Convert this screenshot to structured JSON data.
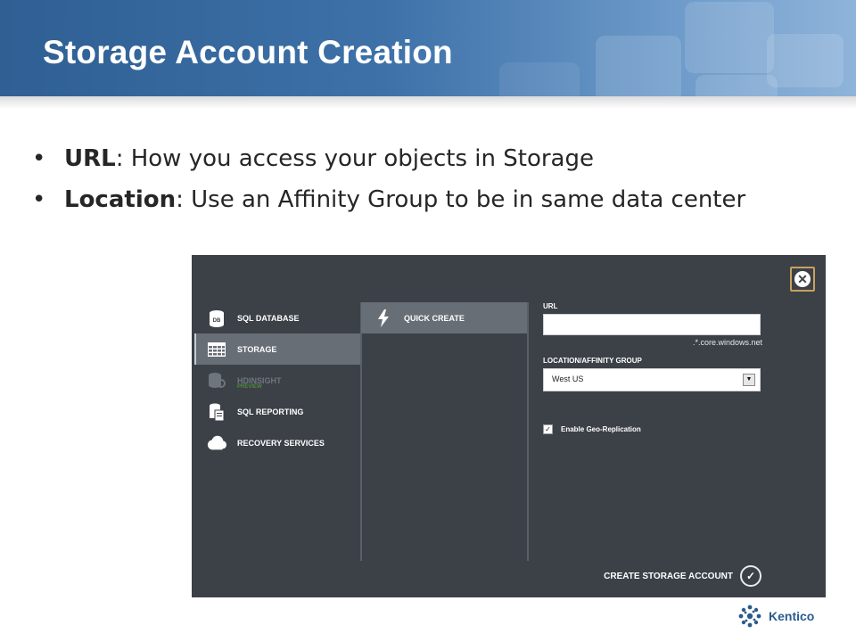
{
  "slide": {
    "title": "Storage Account Creation",
    "bullets": [
      {
        "term": "URL",
        "text": ": How you access your objects in Storage"
      },
      {
        "term": "Location",
        "text": ": Use an Affinity Group to be in same data center"
      }
    ]
  },
  "portal": {
    "services": [
      {
        "label": "SQL DATABASE",
        "icon": "database-icon",
        "selected": false,
        "disabled": false
      },
      {
        "label": "STORAGE",
        "icon": "storage-table-icon",
        "selected": true,
        "disabled": false
      },
      {
        "label": "HDINSIGHT",
        "sublabel": "PREVIEW",
        "icon": "hdinsight-icon",
        "selected": false,
        "disabled": true
      },
      {
        "label": "SQL REPORTING",
        "icon": "report-icon",
        "selected": false,
        "disabled": false
      },
      {
        "label": "RECOVERY SERVICES",
        "icon": "cloud-icon",
        "selected": false,
        "disabled": false
      }
    ],
    "create_options": [
      {
        "label": "QUICK CREATE",
        "icon": "lightning-icon",
        "selected": true
      }
    ],
    "form": {
      "url_label": "URL",
      "url_value": "",
      "url_suffix": ".*.core.windows.net",
      "location_label": "LOCATION/AFFINITY GROUP",
      "location_value": "West US",
      "geo_replication_label": "Enable Geo-Replication",
      "geo_replication_checked": true
    },
    "create_button_label": "CREATE STORAGE ACCOUNT",
    "close_icon": "close-icon",
    "confirm_icon": "checkmark-icon"
  },
  "logo": {
    "text": "Kentico"
  },
  "colors": {
    "banner": "#3d71a8",
    "portal_bg": "#3c4148",
    "selected_item": "#686e76",
    "close_border": "#c9a15a",
    "logo_blue": "#2a5b8c"
  }
}
